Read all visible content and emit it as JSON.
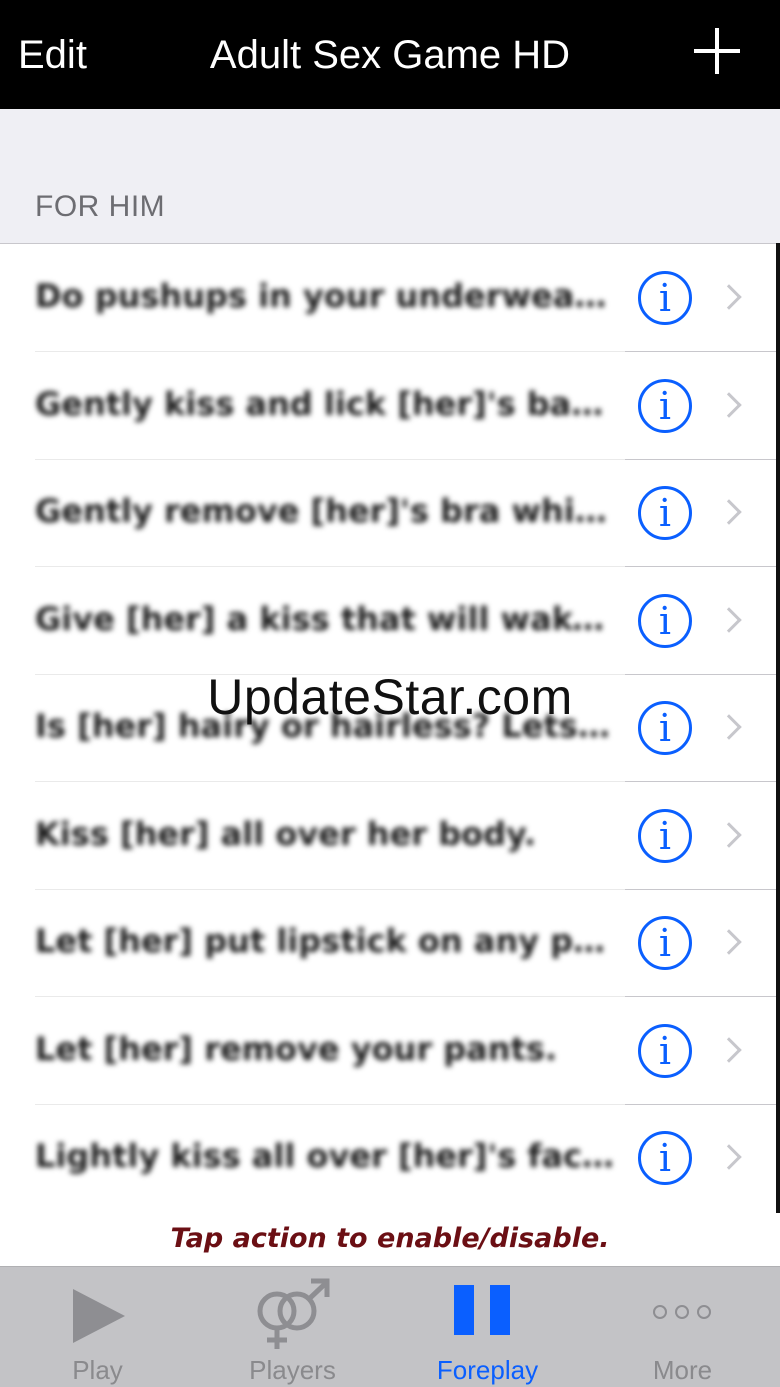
{
  "navbar": {
    "edit_label": "Edit",
    "title": "Adult Sex Game HD",
    "add_icon": "plus-icon"
  },
  "section": {
    "header": "FOR HIM"
  },
  "rows": [
    {
      "text": "Do pushups in your underwear wit..."
    },
    {
      "text": "Gently kiss and lick [her]'s back (no..."
    },
    {
      "text": "Gently remove [her]'s bra while kis..."
    },
    {
      "text": "Give [her] a kiss that will wake he..."
    },
    {
      "text": "Is [her] hairy or hairless? Lets ha..."
    },
    {
      "text": "Kiss [her] all over her body."
    },
    {
      "text": "Let [her] put lipstick on any part o..."
    },
    {
      "text": "Let [her] remove your pants."
    },
    {
      "text": "Lightly kiss all over [her]'s face bu..."
    }
  ],
  "row_icons": {
    "info": "i",
    "chevron": "chevron-right-icon"
  },
  "watermark": "UpdateStar.com",
  "hint": "Tap action to enable/disable.",
  "tabs": [
    {
      "label": "Play",
      "icon": "play-icon"
    },
    {
      "label": "Players",
      "icon": "gender-icon"
    },
    {
      "label": "Foreplay",
      "icon": "pause-icon",
      "active": true
    },
    {
      "label": "More",
      "icon": "more-dots-icon"
    }
  ],
  "colors": {
    "accent": "#0a5fff",
    "hint_text": "#6b0f14",
    "navbar_bg": "#000000",
    "tabbar_bg": "#c3c3c6"
  }
}
